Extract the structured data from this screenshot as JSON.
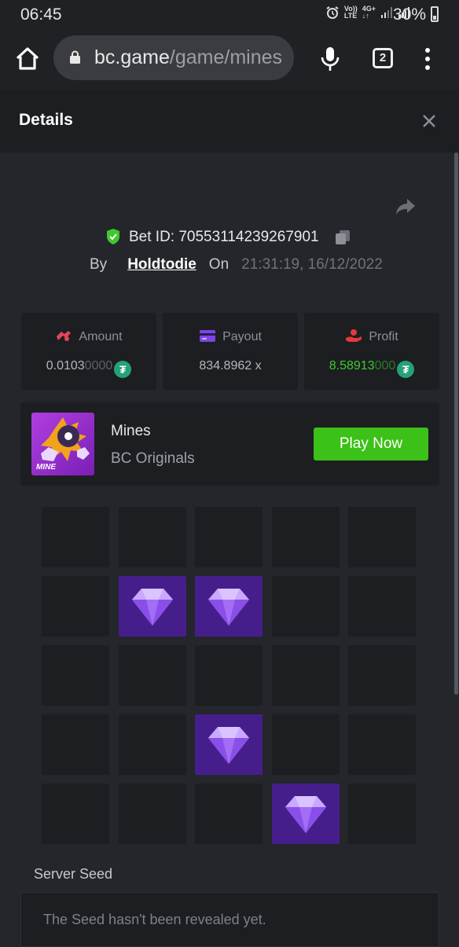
{
  "status_bar": {
    "time": "06:45",
    "battery": "30%",
    "network_icons": [
      "alarm-icon",
      "volte-icon",
      "4g-icon",
      "signal-icon",
      "signal-icon"
    ]
  },
  "browser": {
    "url_domain": "bc.game",
    "url_path": "/game/mines",
    "tab_count": "2"
  },
  "header": {
    "title": "Details"
  },
  "bet": {
    "id_label": "Bet ID: 70553114239267901",
    "by_label": "By",
    "username": "Holdtodie",
    "on_label": "On",
    "datetime": "21:31:19, 16/12/2022"
  },
  "stats": {
    "amount": {
      "label": "Amount",
      "value_main": "0.0103",
      "value_fade": "0000"
    },
    "payout": {
      "label": "Payout",
      "value": "834.8962 x"
    },
    "profit": {
      "label": "Profit",
      "value_main": "8.58913",
      "value_fade": "000"
    },
    "coin_symbol": "₮"
  },
  "game": {
    "thumb_text": "MINE",
    "name": "Mines",
    "provider": "BC Originals",
    "play_label": "Play Now"
  },
  "board": {
    "rows": 5,
    "cols": 5,
    "cells": [
      "",
      "",
      "",
      "",
      "",
      "",
      "gem",
      "gem",
      "",
      "",
      "",
      "",
      "",
      "",
      "",
      "",
      "",
      "gem",
      "",
      "",
      "",
      "",
      "",
      "gem",
      ""
    ]
  },
  "seed": {
    "label": "Server Seed",
    "text": "The Seed hasn't been revealed yet."
  },
  "colors": {
    "accent_green": "#3bc117",
    "gem_tile": "#461e8c",
    "shield_green": "#3fc92e"
  }
}
